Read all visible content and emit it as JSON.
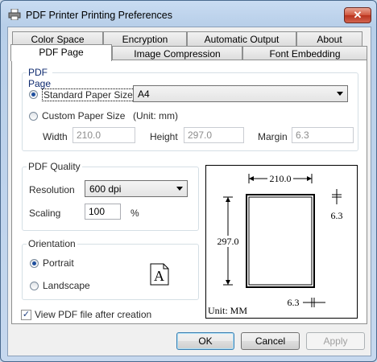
{
  "window": {
    "title": "PDF Printer Printing Preferences",
    "close_label": "✕"
  },
  "tabs_back": [
    "Color Space",
    "Encryption",
    "Automatic Output",
    "About"
  ],
  "tabs_front": [
    "PDF Page",
    "Image Compression",
    "Font Embedding"
  ],
  "pdf_page": {
    "legend": "PDF Page",
    "standard_label": "Standard Paper Size",
    "standard_value": "A4",
    "custom_label": "Custom Paper Size",
    "unit_note": "(Unit: mm)",
    "width_label": "Width",
    "width_value": "210.0",
    "height_label": "Height",
    "height_value": "297.0",
    "margin_label": "Margin",
    "margin_value": "6.3"
  },
  "quality": {
    "legend": "PDF Quality",
    "resolution_label": "Resolution",
    "resolution_value": "600 dpi",
    "scaling_label": "Scaling",
    "scaling_value": "100",
    "scaling_unit": "%"
  },
  "orientation": {
    "legend": "Orientation",
    "portrait_label": "Portrait",
    "landscape_label": "Landscape",
    "icon_letter": "A"
  },
  "preview": {
    "width_dim": "210.0",
    "height_dim": "297.0",
    "margin_top": "6.3",
    "margin_bottom": "6.3",
    "unit": "Unit: MM"
  },
  "view_after": {
    "label": "View PDF file after creation",
    "checked": "✓"
  },
  "buttons": {
    "ok": "OK",
    "cancel": "Cancel",
    "apply": "Apply"
  }
}
